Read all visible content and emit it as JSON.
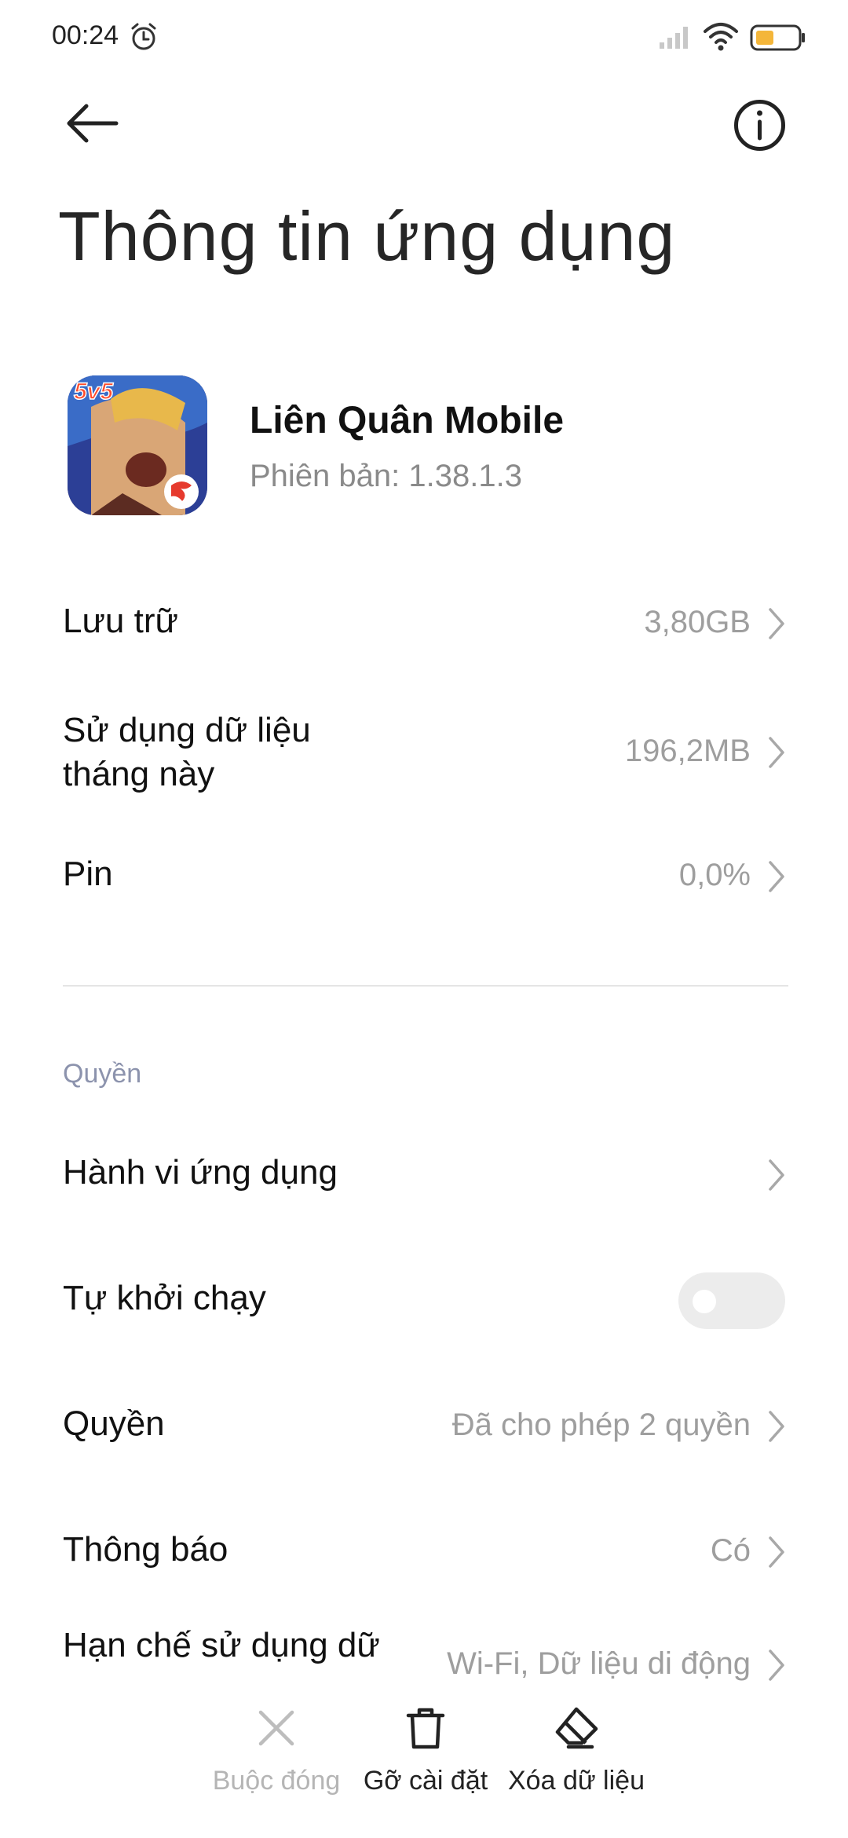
{
  "status_bar": {
    "time": "00:24",
    "icons": [
      "alarm-icon",
      "signal-icon",
      "wifi-icon",
      "battery-icon"
    ],
    "battery_color": "#f4b63a"
  },
  "header": {
    "back_icon": "arrow-left-icon",
    "info_icon": "info-icon",
    "title": "Thông tin ứng dụng"
  },
  "app": {
    "name": "Liên Quân Mobile",
    "version": "Phiên bản: 1.38.1.3",
    "icon_badge": "5v5"
  },
  "usage_rows": [
    {
      "label": "Lưu trữ",
      "value": "3,80GB"
    },
    {
      "label_line1": "Sử dụng dữ liệu",
      "label_line2": "tháng này",
      "value": "196,2MB"
    },
    {
      "label": "Pin",
      "value": "0,0%"
    }
  ],
  "permissions_section": {
    "header": "Quyền",
    "rows": [
      {
        "label": "Hành vi ứng dụng",
        "value": ""
      },
      {
        "label": "Tự khởi chạy",
        "toggle": "off"
      },
      {
        "label": "Quyền",
        "value": "Đã cho phép 2 quyền"
      },
      {
        "label": "Thông báo",
        "value": "Có"
      },
      {
        "label": "Hạn chế sử dụng dữ",
        "value": "Wi-Fi, Dữ liệu di động"
      }
    ]
  },
  "bottom_actions": [
    {
      "label": "Buộc đóng",
      "icon": "close-icon",
      "enabled": false
    },
    {
      "label": "Gỡ cài đặt",
      "icon": "trash-icon",
      "enabled": true
    },
    {
      "label": "Xóa dữ liệu",
      "icon": "eraser-icon",
      "enabled": true
    }
  ],
  "colors": {
    "text_primary": "#111111",
    "text_secondary": "#9e9e9e",
    "section_header": "#8c93ad",
    "disabled": "#b5b5b5"
  }
}
